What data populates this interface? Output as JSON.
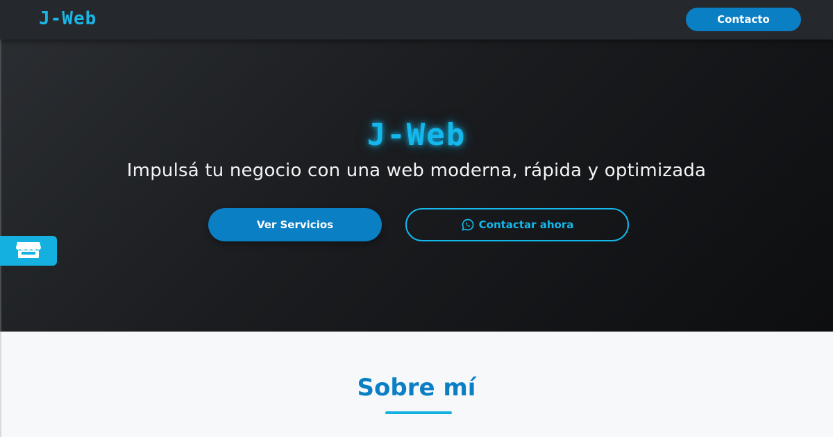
{
  "navbar": {
    "brand": "J-Web",
    "contact_label": "Contacto"
  },
  "hero": {
    "title": "J-Web",
    "subtitle": "Impulsá tu negocio con una web moderna, rápida y optimizada",
    "services_button_label": "Ver Servicios",
    "whatsapp_button_label": "Contactar ahora",
    "whatsapp_icon": "whatsapp-icon",
    "side_tab_icon": "store-icon"
  },
  "about": {
    "title": "Sobre mí"
  },
  "colors": {
    "accent_blue": "#0b7fc4",
    "accent_cyan": "#14b8ec",
    "navbar_bg": "#25282c",
    "hero_bg_dark": "#0d0e10",
    "about_bg": "#f6f8fa"
  }
}
